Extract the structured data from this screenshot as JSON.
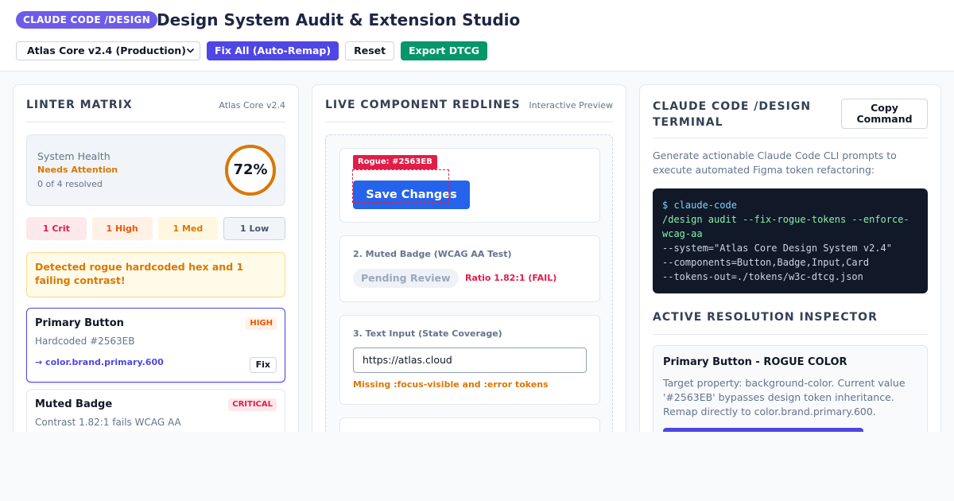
{
  "header": {
    "brand_pill": "CLAUDE CODE /DESIGN",
    "title": "Design System Audit & Extension Studio",
    "system_select": "Atlas Core v2.4 (Production)",
    "fix_all": "Fix All (Auto-Remap)",
    "reset": "Reset",
    "export": "Export DTCG"
  },
  "linter": {
    "title": "LINTER MATRIX",
    "subtitle": "Atlas Core v2.4",
    "health": {
      "label": "System Health",
      "status": "Needs Attention",
      "resolved": "0 of 4 resolved",
      "score": "72%"
    },
    "severity": {
      "crit": "1 Crit",
      "high": "1 High",
      "med": "1 Med",
      "low": "1 Low"
    },
    "alert": "Detected rogue hardcoded hex and 1 failing contrast!",
    "issues": [
      {
        "name": "Primary Button",
        "tag": "HIGH",
        "desc": "Hardcoded #2563EB",
        "remap": "→ color.brand.primary.600",
        "fix": "Fix"
      },
      {
        "name": "Muted Badge",
        "tag": "CRITICAL",
        "desc": "Contrast 1.82:1 fails WCAG AA"
      }
    ]
  },
  "preview": {
    "title": "LIVE COMPONENT REDLINES",
    "subtitle": "Interactive Preview",
    "button_card": {
      "rogue_tag": "Rogue: #2563EB",
      "button_label": "Save Changes"
    },
    "badge_card": {
      "label": "2. Muted Badge (WCAG AA Test)",
      "badge": "Pending Review",
      "ratio": "Ratio 1.82:1 (FAIL)"
    },
    "input_card": {
      "label": "3. Text Input (State Coverage)",
      "value": "https://atlas.cloud",
      "missing": "Missing :focus-visible and :error tokens"
    }
  },
  "terminal": {
    "title": "CLAUDE CODE /DESIGN TERMINAL",
    "copy": "Copy Command",
    "description": "Generate actionable Claude Code CLI prompts to execute automated Figma token refactoring:",
    "lines": {
      "prompt": "$ claude-code",
      "cmd1": "/design audit --fix-rogue-tokens --enforce-",
      "cmd2": "wcag-aa",
      "arg1": "--system=\"Atlas Core Design System v2.4\"",
      "arg2": "--components=Button,Badge,Input,Card",
      "arg3": "--tokens-out=./tokens/w3c-dtcg.json"
    }
  },
  "inspector": {
    "title": "ACTIVE RESOLUTION INSPECTOR",
    "name": "Primary Button - ROGUE COLOR",
    "text": "Target property: background-color. Current value '#2563EB' bypasses design token inheritance. Remap directly to color.brand.primary.600."
  }
}
